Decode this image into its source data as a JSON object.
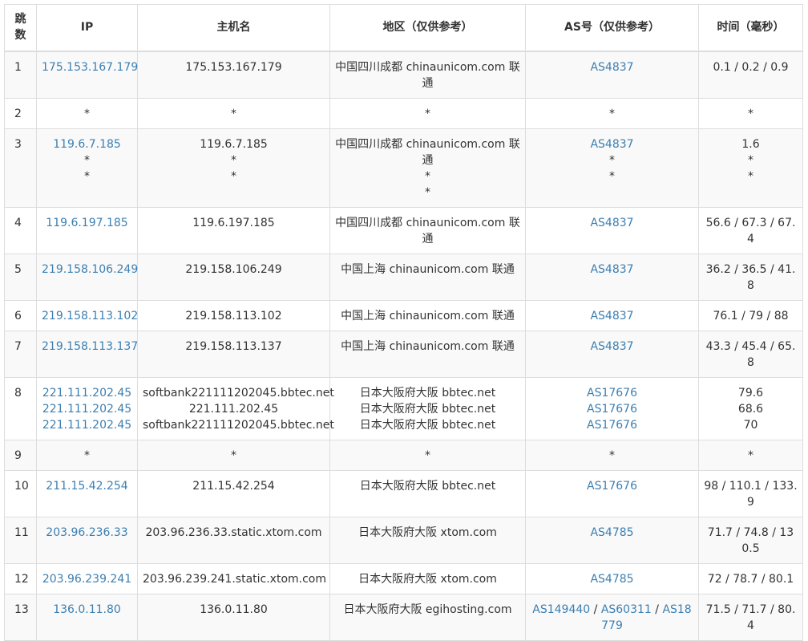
{
  "headers": {
    "hop": "跳数",
    "ip": "IP",
    "host": "主机名",
    "region": "地区（仅供参考）",
    "as": "AS号（仅供参考）",
    "time": "时间（毫秒）"
  },
  "colors": {
    "link": "#3c7fb1",
    "border": "#dddddd",
    "row_alt": "#f9f9f9"
  },
  "rows": [
    {
      "hop": "1",
      "ip": [
        "175.153.167.179"
      ],
      "host": [
        "175.153.167.179"
      ],
      "region": [
        "中国四川成都 chinaunicom.com 联通"
      ],
      "as": [
        "AS4837"
      ],
      "time": "0.1 / 0.2 / 0.9"
    },
    {
      "hop": "2",
      "ip": [
        "*"
      ],
      "host": [
        "*"
      ],
      "region": [
        "*"
      ],
      "as": [
        "*"
      ],
      "time": "*"
    },
    {
      "hop": "3",
      "ip": [
        "119.6.7.185",
        "*",
        "*"
      ],
      "host": [
        "119.6.7.185",
        "*",
        "*"
      ],
      "region": [
        "中国四川成都 chinaunicom.com 联通",
        "*",
        "*"
      ],
      "as": [
        "AS4837",
        "*",
        "*"
      ],
      "time_lines": [
        "1.6",
        "*",
        "*"
      ]
    },
    {
      "hop": "4",
      "ip": [
        "119.6.197.185"
      ],
      "host": [
        "119.6.197.185"
      ],
      "region": [
        "中国四川成都 chinaunicom.com 联通"
      ],
      "as": [
        "AS4837"
      ],
      "time": "56.6 / 67.3 / 67.4"
    },
    {
      "hop": "5",
      "ip": [
        "219.158.106.249"
      ],
      "host": [
        "219.158.106.249"
      ],
      "region": [
        "中国上海 chinaunicom.com 联通"
      ],
      "as": [
        "AS4837"
      ],
      "time": "36.2 / 36.5 / 41.8"
    },
    {
      "hop": "6",
      "ip": [
        "219.158.113.102"
      ],
      "host": [
        "219.158.113.102"
      ],
      "region": [
        "中国上海 chinaunicom.com 联通"
      ],
      "as": [
        "AS4837"
      ],
      "time": "76.1 / 79 / 88"
    },
    {
      "hop": "7",
      "ip": [
        "219.158.113.137"
      ],
      "host": [
        "219.158.113.137"
      ],
      "region": [
        "中国上海 chinaunicom.com 联通"
      ],
      "as": [
        "AS4837"
      ],
      "time": "43.3 / 45.4 / 65.8"
    },
    {
      "hop": "8",
      "ip": [
        "221.111.202.45",
        "221.111.202.45",
        "221.111.202.45"
      ],
      "host": [
        "softbank221111202045.bbtec.net",
        "221.111.202.45",
        "softbank221111202045.bbtec.net"
      ],
      "region": [
        "日本大阪府大阪 bbtec.net",
        "日本大阪府大阪 bbtec.net",
        "日本大阪府大阪 bbtec.net"
      ],
      "as": [
        "AS17676",
        "AS17676",
        "AS17676"
      ],
      "time_lines": [
        "79.6",
        "68.6",
        "70"
      ]
    },
    {
      "hop": "9",
      "ip": [
        "*"
      ],
      "host": [
        "*"
      ],
      "region": [
        "*"
      ],
      "as": [
        "*"
      ],
      "time": "*"
    },
    {
      "hop": "10",
      "ip": [
        "211.15.42.254"
      ],
      "host": [
        "211.15.42.254"
      ],
      "region": [
        "日本大阪府大阪 bbtec.net"
      ],
      "as": [
        "AS17676"
      ],
      "time": "98 / 110.1 / 133.9"
    },
    {
      "hop": "11",
      "ip": [
        "203.96.236.33"
      ],
      "host": [
        "203.96.236.33.static.xtom.com"
      ],
      "region": [
        "日本大阪府大阪 xtom.com"
      ],
      "as": [
        "AS4785"
      ],
      "time": "71.7 / 74.8 / 130.5"
    },
    {
      "hop": "12",
      "ip": [
        "203.96.239.241"
      ],
      "host": [
        "203.96.239.241.static.xtom.com"
      ],
      "region": [
        "日本大阪府大阪 xtom.com"
      ],
      "as": [
        "AS4785"
      ],
      "time": "72 / 78.7 / 80.1"
    },
    {
      "hop": "13",
      "ip": [
        "136.0.11.80"
      ],
      "host": [
        "136.0.11.80"
      ],
      "region": [
        "日本大阪府大阪 egihosting.com"
      ],
      "as_multi": [
        "AS149440",
        "AS60311",
        "AS18779"
      ],
      "time": "71.5 / 71.7 / 80.4"
    }
  ]
}
